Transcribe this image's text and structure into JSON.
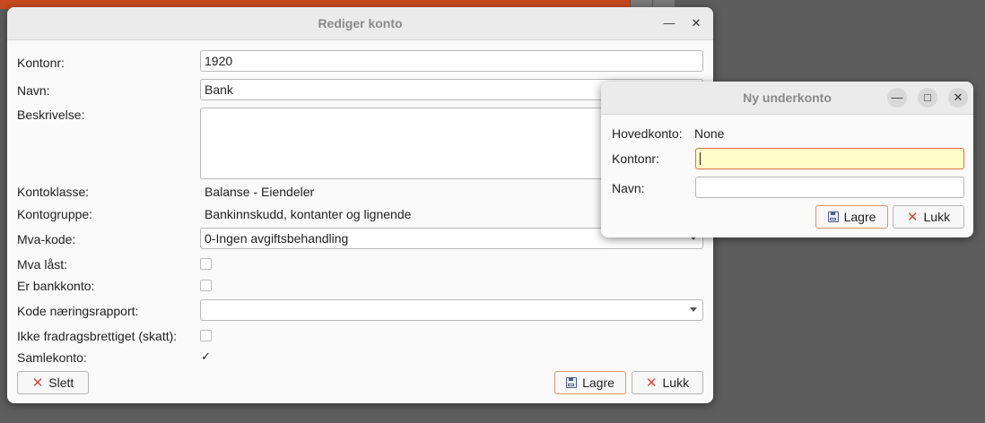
{
  "background_window": {
    "title": "Rediger konto"
  },
  "main_dialog": {
    "title": "Rediger konto",
    "minimize_icon": "minimize-icon",
    "close_icon": "close-icon",
    "fields": {
      "kontonr_label": "Kontonr:",
      "kontonr_value": "1920",
      "navn_label": "Navn:",
      "navn_value": "Bank",
      "beskrivelse_label": "Beskrivelse:",
      "beskrivelse_value": "",
      "kontoklasse_label": "Kontoklasse:",
      "kontoklasse_value": "Balanse - Eiendeler",
      "kontogruppe_label": "Kontogruppe:",
      "kontogruppe_value": "Bankinnskudd, kontanter og lignende",
      "mva_kode_label": "Mva-kode:",
      "mva_kode_value": "0-Ingen avgiftsbehandling",
      "mva_last_label": "Mva låst:",
      "mva_last_checked": false,
      "er_bankkonto_label": "Er bankkonto:",
      "er_bankkonto_checked": false,
      "kode_naeringsrapport_label": "Kode næringsrapport:",
      "kode_naeringsrapport_value": "",
      "ikke_fradragsberettiget_label": "Ikke fradragsbrettiget (skatt):",
      "ikke_fradragsberettiget_checked": false,
      "samlekonto_label": "Samlekonto:",
      "samlekonto_checked": true,
      "check_mark": "✓"
    },
    "buttons": {
      "delete_label": "Slett",
      "save_label": "Lagre",
      "close_label": "Lukk"
    }
  },
  "sub_dialog": {
    "title": "Ny underkonto",
    "hovedkonto_label": "Hovedkonto:",
    "hovedkonto_value": "None",
    "kontonr_label": "Kontonr:",
    "kontonr_value": "",
    "navn_label": "Navn:",
    "navn_value": "",
    "buttons": {
      "save_label": "Lagre",
      "close_label": "Lukk"
    }
  },
  "colors": {
    "desktop": "#5d5d5d",
    "accent_border": "#e0704a",
    "focus_fill": "#fffdc8",
    "delete_icon": "#e04545"
  }
}
